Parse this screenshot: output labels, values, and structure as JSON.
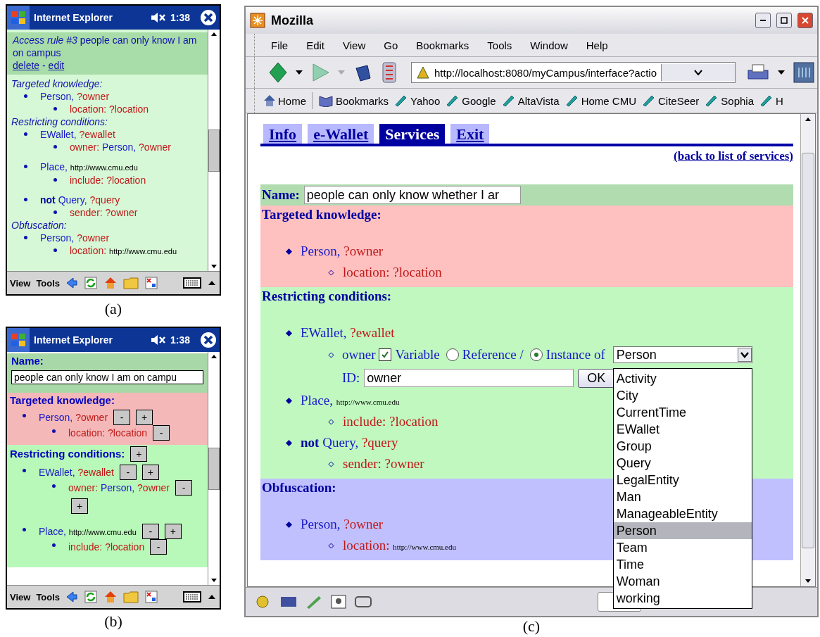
{
  "pda_a": {
    "title": "Internet Explorer",
    "time": "1:38",
    "header": {
      "text": "*Access rule #3* people can only know I am on campus",
      "links": [
        "delete",
        "edit"
      ],
      "separator": "-"
    },
    "sections": [
      {
        "heading": "Targeted knowledge:",
        "items": [
          {
            "segments": [
              {
                "text": "Person,",
                "kind": "class"
              },
              {
                "text": "?owner",
                "kind": "var"
              }
            ],
            "children": [
              {
                "segments": [
                  {
                    "text": "location: ?location",
                    "kind": "prop"
                  }
                ]
              }
            ]
          }
        ]
      },
      {
        "heading": "Restricting conditions:",
        "items": [
          {
            "segments": [
              {
                "text": "EWallet,",
                "kind": "class"
              },
              {
                "text": "?ewallet",
                "kind": "var"
              }
            ],
            "children": [
              {
                "segments": [
                  {
                    "text": "owner:",
                    "kind": "prop"
                  },
                  {
                    "text": "Person,",
                    "kind": "class"
                  },
                  {
                    "text": "?owner",
                    "kind": "var"
                  }
                ]
              }
            ]
          },
          {
            "segments": [
              {
                "text": "Place,",
                "kind": "class"
              },
              {
                "text": "http://www.cmu.edu",
                "kind": "url"
              }
            ],
            "children": [
              {
                "segments": [
                  {
                    "text": "include: ?location",
                    "kind": "prop"
                  }
                ]
              }
            ]
          },
          {
            "segments": [
              {
                "text": "not",
                "kind": "keyword"
              },
              {
                "text": "Query,",
                "kind": "class"
              },
              {
                "text": "?query",
                "kind": "var"
              }
            ],
            "children": [
              {
                "segments": [
                  {
                    "text": "sender: ?owner",
                    "kind": "prop"
                  }
                ]
              }
            ]
          }
        ]
      },
      {
        "heading": "Obfuscation:",
        "items": [
          {
            "segments": [
              {
                "text": "Person,",
                "kind": "class"
              },
              {
                "text": "?owner",
                "kind": "var"
              }
            ],
            "children": [
              {
                "segments": [
                  {
                    "text": "location:",
                    "kind": "prop"
                  },
                  {
                    "text": "http://www.cmu.edu",
                    "kind": "url"
                  }
                ]
              }
            ]
          }
        ]
      }
    ],
    "menus": [
      "View",
      "Tools"
    ]
  },
  "caption_a": "(a)",
  "pda_b": {
    "title": "Internet Explorer",
    "time": "1:38",
    "name": {
      "label": "Name:",
      "value": "people can only know I am on campu"
    },
    "sections": [
      {
        "heading": "Targeted knowledge:",
        "color": "#f4b8b8",
        "items": [
          {
            "segments": [
              {
                "text": "Person,",
                "kind": "class"
              },
              {
                "text": "?owner",
                "kind": "var"
              }
            ],
            "buttons": [
              "-",
              "+"
            ],
            "children": [
              {
                "segments": [
                  {
                    "text": "location: ?location",
                    "kind": "prop"
                  }
                ],
                "buttons": [
                  "-"
                ]
              }
            ]
          }
        ]
      },
      {
        "heading": "Restricting conditions:",
        "color": "#b8f8b8",
        "buttons": [
          "+"
        ],
        "items": [
          {
            "segments": [
              {
                "text": "EWallet,",
                "kind": "class"
              },
              {
                "text": "?ewallet",
                "kind": "var"
              }
            ],
            "buttons": [
              "-",
              "+"
            ],
            "children": [
              {
                "segments": [
                  {
                    "text": "owner:",
                    "kind": "prop"
                  },
                  {
                    "text": "Person,",
                    "kind": "class"
                  },
                  {
                    "text": "?owner",
                    "kind": "var"
                  }
                ],
                "buttons": [
                  "-",
                  "+"
                ]
              }
            ]
          },
          {
            "segments": [
              {
                "text": "Place,",
                "kind": "class"
              },
              {
                "text": "http://www.cmu.edu",
                "kind": "url"
              }
            ],
            "buttons": [
              "-",
              "+"
            ],
            "children": [
              {
                "segments": [
                  {
                    "text": "include: ?location",
                    "kind": "prop"
                  }
                ],
                "buttons": [
                  "-"
                ]
              }
            ]
          }
        ]
      }
    ],
    "menus": [
      "View",
      "Tools"
    ]
  },
  "caption_b": "(b)",
  "browser": {
    "title": "Mozilla",
    "menus": [
      "File",
      "Edit",
      "View",
      "Go",
      "Bookmarks",
      "Tools",
      "Window",
      "Help"
    ],
    "url": "http://localhost:8080/myCampus/interface?actio",
    "bookmarks": [
      {
        "label": "Home",
        "kind": "home"
      },
      {
        "label": "Bookmarks",
        "kind": "folder"
      },
      {
        "label": "Yahoo",
        "kind": "link"
      },
      {
        "label": "Google",
        "kind": "link"
      },
      {
        "label": "AltaVista",
        "kind": "link"
      },
      {
        "label": "Home CMU",
        "kind": "link"
      },
      {
        "label": "CiteSeer",
        "kind": "link"
      },
      {
        "label": "Sophia",
        "kind": "link"
      },
      {
        "label": "H",
        "kind": "link"
      }
    ],
    "tabs": [
      {
        "label": "Info",
        "selected": false
      },
      {
        "label": "e-Wallet",
        "selected": false
      },
      {
        "label": "Services",
        "selected": true
      },
      {
        "label": "Exit",
        "selected": false
      }
    ],
    "back_link": "(back to list of services)",
    "name": {
      "label": "Name:",
      "value": "people can only know whether I ar"
    },
    "sections": [
      {
        "heading": "Targeted knowledge:",
        "color": "#ffc0c0",
        "items": [
          {
            "segments": [
              {
                "text": "Person,",
                "kind": "class"
              },
              {
                "text": "?owner",
                "kind": "var"
              }
            ],
            "children": [
              {
                "kind": "line",
                "segments": [
                  {
                    "text": "location: ?location",
                    "kind": "prop"
                  }
                ]
              }
            ]
          }
        ]
      },
      {
        "heading": "Restricting conditions:",
        "color": "#c0f8c0",
        "items": [
          {
            "segments": [
              {
                "text": "EWallet,",
                "kind": "class"
              },
              {
                "text": "?ewallet",
                "kind": "var"
              }
            ],
            "children": [
              {
                "kind": "editor",
                "property": "owner",
                "checkbox": {
                  "label": "Variable",
                  "checked": true
                },
                "radios": [
                  {
                    "label": "Reference /",
                    "selected": false
                  },
                  {
                    "label": "Instance of",
                    "selected": true
                  }
                ],
                "select": {
                  "value": "Person",
                  "options": [
                    {
                      "label": "Activity",
                      "selected": false
                    },
                    {
                      "label": "City",
                      "selected": false
                    },
                    {
                      "label": "CurrentTime",
                      "selected": false
                    },
                    {
                      "label": "EWallet",
                      "selected": false
                    },
                    {
                      "label": "Group",
                      "selected": false
                    },
                    {
                      "label": "Query",
                      "selected": false
                    },
                    {
                      "label": "LegalEntity",
                      "selected": false
                    },
                    {
                      "label": "Man",
                      "selected": false
                    },
                    {
                      "label": "ManageableEntity",
                      "selected": false
                    },
                    {
                      "label": "Person",
                      "selected": true
                    },
                    {
                      "label": "Team",
                      "selected": false
                    },
                    {
                      "label": "Time",
                      "selected": false
                    },
                    {
                      "label": "Woman",
                      "selected": false
                    },
                    {
                      "label": "working",
                      "selected": false
                    }
                  ]
                },
                "id": {
                  "label": "ID:",
                  "value": "owner"
                },
                "ok": "OK"
              }
            ]
          },
          {
            "segments": [
              {
                "text": "Place,",
                "kind": "class"
              },
              {
                "text": "http://www.cmu.edu",
                "kind": "url"
              }
            ],
            "children": [
              {
                "kind": "line",
                "segments": [
                  {
                    "text": "include: ?location",
                    "kind": "prop"
                  }
                ]
              }
            ]
          },
          {
            "segments": [
              {
                "text": "not",
                "kind": "keyword"
              },
              {
                "text": "Query,",
                "kind": "class"
              },
              {
                "text": "?query",
                "kind": "var"
              }
            ],
            "children": [
              {
                "kind": "line",
                "segments": [
                  {
                    "text": "sender: ?owner",
                    "kind": "prop"
                  }
                ]
              }
            ]
          }
        ]
      },
      {
        "heading": "Obfuscation:",
        "color": "#c0c0ff",
        "items": [
          {
            "segments": [
              {
                "text": "Person,",
                "kind": "class"
              },
              {
                "text": "?owner",
                "kind": "var"
              }
            ],
            "children": [
              {
                "kind": "line",
                "segments": [
                  {
                    "text": "location:",
                    "kind": "prop"
                  },
                  {
                    "text": "http://www.cmu.edu",
                    "kind": "url"
                  }
                ]
              }
            ]
          }
        ]
      }
    ]
  },
  "caption_c": "(c)"
}
